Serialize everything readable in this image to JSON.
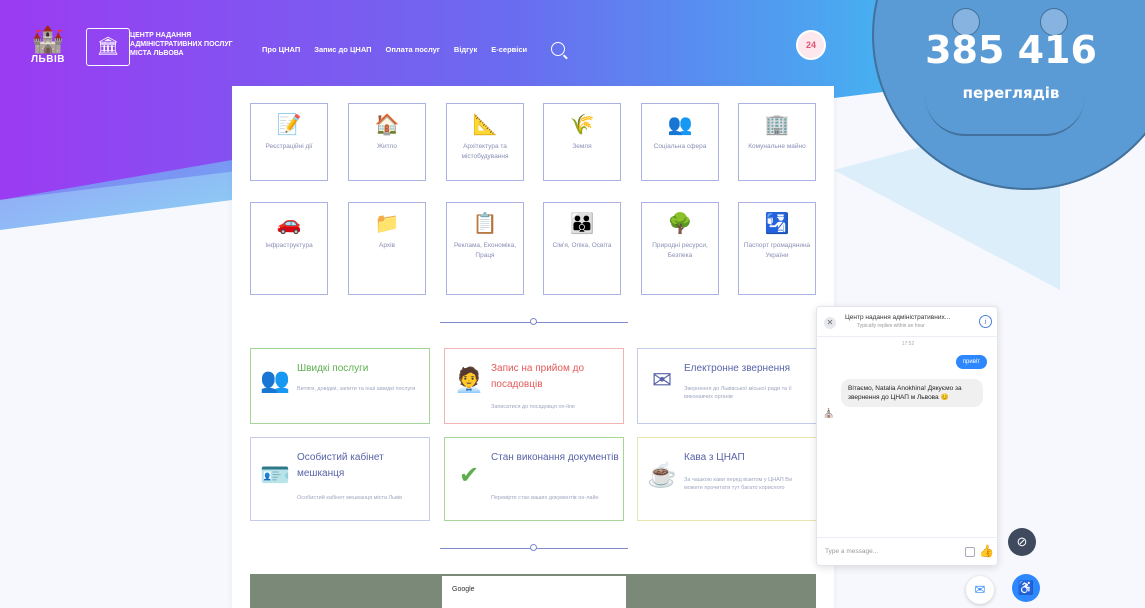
{
  "header": {
    "lviv_logo_text": "ЛЬВІВ",
    "cnap_title": "ЦЕНТР НАДАННЯ АДМІНІСТРАТИВНИХ ПОСЛУГ МІСТА ЛЬВОВА",
    "nav": [
      {
        "label": "Про ЦНАП"
      },
      {
        "label": "Запис до ЦНАП"
      },
      {
        "label": "Оплата послуг"
      },
      {
        "label": "Відгук"
      },
      {
        "label": "Е-сервіси"
      }
    ],
    "badge": "24"
  },
  "tiles": [
    {
      "label": "Реєстраційні дії",
      "icon": "document-edit-icon",
      "glyph": "📝"
    },
    {
      "label": "Житло",
      "icon": "house-icon",
      "glyph": "🏠"
    },
    {
      "label": "Архітектура та містобудування",
      "icon": "compass-icon",
      "glyph": "📐"
    },
    {
      "label": "Земля",
      "icon": "field-icon",
      "glyph": "🌾"
    },
    {
      "label": "Соціальна сфера",
      "icon": "people-icon",
      "glyph": "👥"
    },
    {
      "label": "Комунальне майно",
      "icon": "building-icon",
      "glyph": "🏢"
    },
    {
      "label": "Інфраструктура",
      "icon": "car-icon",
      "glyph": "🚗"
    },
    {
      "label": "Архів",
      "icon": "folder-icon",
      "glyph": "📁"
    },
    {
      "label": "Реклама, Економіка, Праця",
      "icon": "billboard-icon",
      "glyph": "📋"
    },
    {
      "label": "Сім'я, Опіка, Освіта",
      "icon": "family-icon",
      "glyph": "👪"
    },
    {
      "label": "Природні ресурси, Безпека",
      "icon": "nature-icon",
      "glyph": "🌳"
    },
    {
      "label": "Паспорт громадянина України",
      "icon": "passport-icon",
      "glyph": "🛂"
    }
  ],
  "cards": [
    {
      "title": "Швидкі послуги",
      "desc": "Витяги, довідки, запити та інші швидкі послуги",
      "color": "#5dae4e",
      "icon": "fast-services-icon",
      "glyph": "👥"
    },
    {
      "title": "Запис на прийом до посадовців",
      "desc": "Записатися до посадовця on-line",
      "color": "#e35a5a",
      "icon": "appointment-icon",
      "glyph": "🧑‍💼"
    },
    {
      "title": "Електронне звернення",
      "desc": "Звернення до Львівської міської ради та її виконавчих органів",
      "color": "#5863a8",
      "icon": "email-icon",
      "glyph": "✉"
    },
    {
      "title": "Особистий кабінет мешканця",
      "desc": "Особистий кабінет мешканця міста Львів",
      "color": "#5863a8",
      "icon": "cabinet-icon",
      "glyph": "🪪"
    },
    {
      "title": "Стан виконання документів",
      "desc": "Перевірте стан ваших документів он-лайн",
      "color": "#5dae4e",
      "icon": "check-icon",
      "glyph": "✔"
    },
    {
      "title": "Кава з ЦНАП",
      "desc": "За чашкою кави перед візитом у ЦНАП Ви можете прочитати тут багато корисного",
      "color": "#5863a8",
      "icon": "coffee-icon",
      "glyph": "☕"
    }
  ],
  "map": {
    "popup_title": "Google"
  },
  "chat": {
    "name": "Центр надання адміністративних...",
    "subtitle": "Typically replies within an hour",
    "time": "17:52",
    "my_message": "привіт",
    "reply": "Вітаємо, Natalia Anokhina! Дякуємо за звернення до ЦНАП м Львова 😊",
    "placeholder": "Type a message..."
  },
  "counter": {
    "number": "385 416",
    "label": "переглядів"
  },
  "colors": {
    "accent": "#5863a8",
    "counter_bg": "#5b9bd5"
  }
}
